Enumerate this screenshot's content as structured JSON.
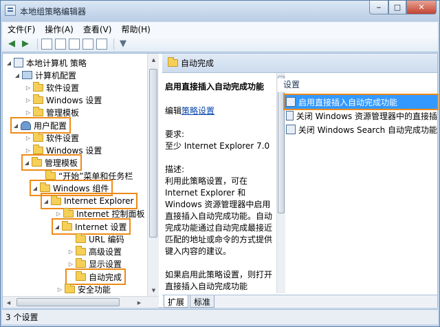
{
  "window": {
    "title": "本地组策略编辑器",
    "controls": [
      "minimize",
      "maximize",
      "close"
    ]
  },
  "menu": [
    "文件(F)",
    "操作(A)",
    "查看(V)",
    "帮助(H)"
  ],
  "toolbar": [
    "back-icon",
    "forward-icon",
    "up-folder-icon",
    "show-hide-tree-icon",
    "export-list-icon",
    "help-icon",
    "properties-icon",
    "filter-icon"
  ],
  "tree": [
    {
      "label": "本地计算机 策略",
      "expanded": true
    },
    {
      "label": "计算机配置",
      "expanded": true
    },
    {
      "label": "软件设置"
    },
    {
      "label": "Windows 设置"
    },
    {
      "label": "管理模板"
    },
    {
      "label": "用户配置",
      "expanded": true
    },
    {
      "label": "软件设置"
    },
    {
      "label": "Windows 设置"
    },
    {
      "label": "管理模板",
      "expanded": true
    },
    {
      "label": "“开始”菜单和任务栏"
    },
    {
      "label": "Windows 组件",
      "expanded": true
    },
    {
      "label": "Internet Explorer",
      "expanded": true
    },
    {
      "label": "Internet 控制面板"
    },
    {
      "label": "Internet 设置",
      "expanded": true
    },
    {
      "label": "URL 编码"
    },
    {
      "label": "高级设置"
    },
    {
      "label": "显示设置"
    },
    {
      "label": "自动完成",
      "selected": true
    },
    {
      "label": "安全功能"
    }
  ],
  "right_header": "自动完成",
  "description": {
    "title": "启用直接插入自动完成功能",
    "edit_prefix": "编辑",
    "edit_link": "策略设置",
    "req_label": "要求:",
    "req_value": "至少 Internet Explorer 7.0",
    "desc_label": "描述:",
    "desc_text": "利用此策略设置，可在 Internet Explorer 和 Windows 资源管理器中启用直接插入自动完成功能。自动完成功能通过自动完成最接近匹配的地址或命令的方式提供键入内容的建议。",
    "desc_text2": "如果启用此策略设置，则打开直接插入自动完成功能"
  },
  "settings": {
    "column_header": "设置",
    "items": [
      {
        "label": "启用直接插入自动完成功能",
        "selected": true
      },
      {
        "label": "关闭 Windows 资源管理器中的直接插"
      },
      {
        "label": "关闭 Windows Search 自动完成功能"
      }
    ]
  },
  "tabs": [
    "扩展",
    "标准"
  ],
  "status": "3 个设置",
  "colors": {
    "highlight": "#ef8a17",
    "selection": "#3399ff",
    "titlebar": "#c5d6ea"
  }
}
